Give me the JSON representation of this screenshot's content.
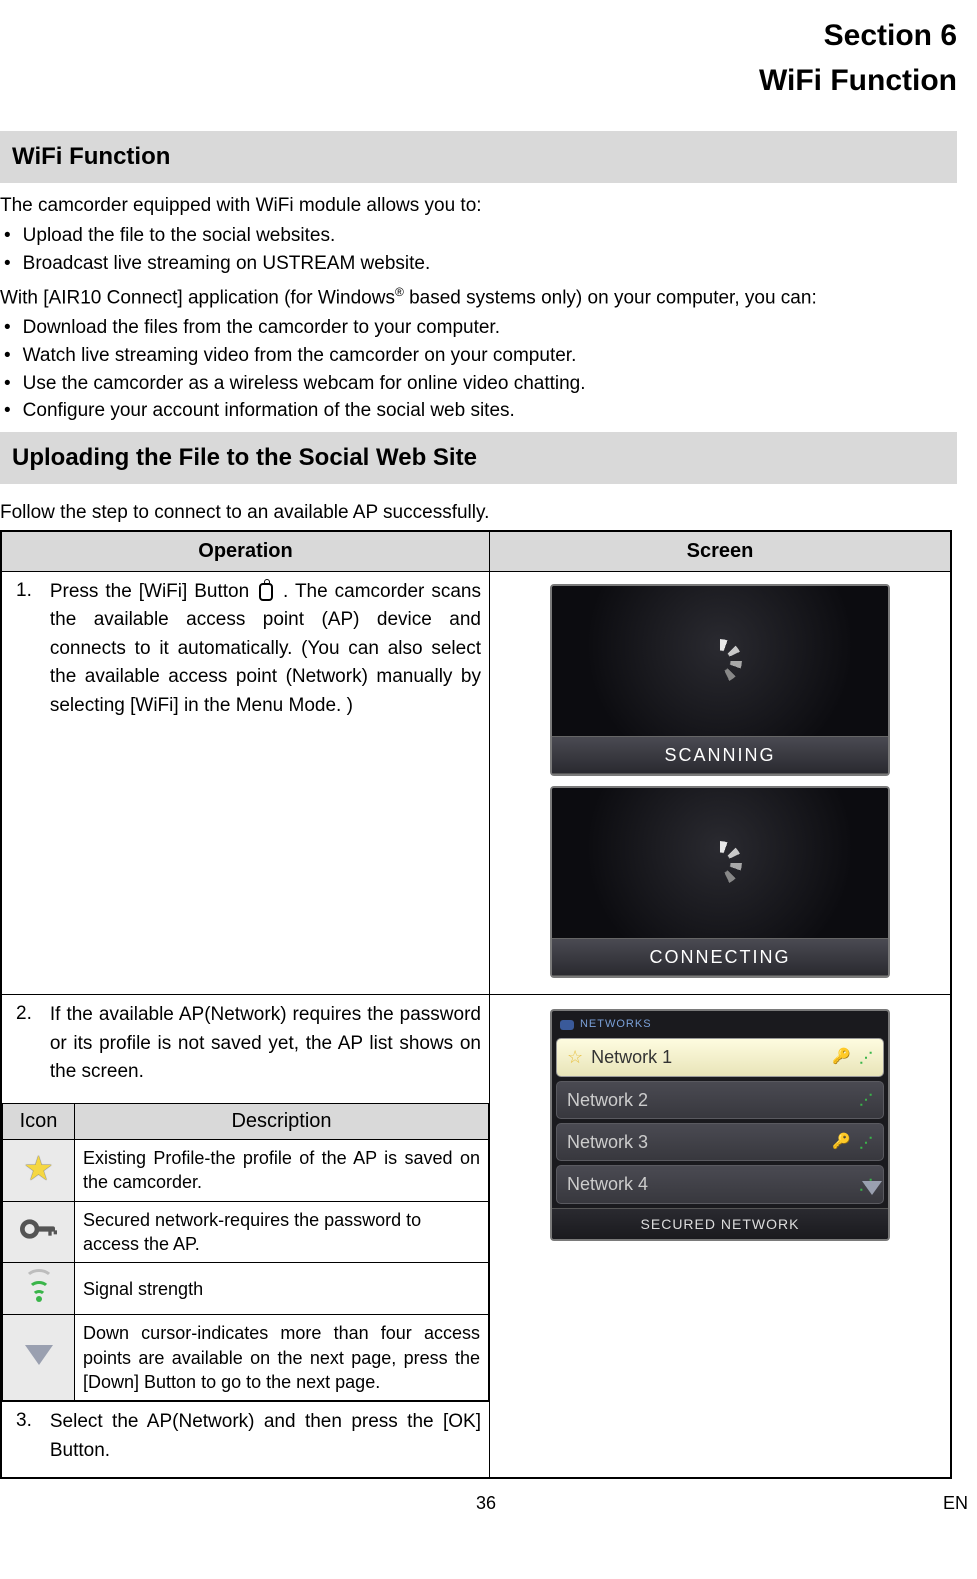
{
  "section": {
    "label": "Section 6",
    "title": "WiFi Function"
  },
  "bars": {
    "wifi_function": "WiFi Function",
    "uploading": "Uploading the File to the Social Web Site"
  },
  "intro": {
    "lead": "The camcorder equipped with WiFi module allows you to:",
    "bullets1": [
      "Upload the file to the social websites.",
      "Broadcast live streaming on USTREAM website."
    ],
    "with_line_pre": "With [AIR10 Connect] application (for Windows",
    "with_line_sup": "®",
    "with_line_post": " based systems only) on your computer, you can:",
    "bullets2": [
      "Download the files from the camcorder to your computer.",
      "Watch live streaming video from the camcorder on your computer.",
      "Use the camcorder as a wireless webcam for online video chatting.",
      "Configure your account information of the social web sites."
    ]
  },
  "follow_text": "Follow the step to connect to an available AP successfully.",
  "table": {
    "head": {
      "operation": "Operation",
      "screen": "Screen"
    },
    "row1": {
      "num": "1.",
      "text_pre": "Press the [WiFi] Button ",
      "text_post": " . The camcorder scans the available access point (AP) device and connects to it automatically.  (You can also select the available access point (Network) manually by selecting [WiFi] in the Menu Mode. )",
      "screen_labels": {
        "scanning": "SCANNING",
        "connecting": "CONNECTING"
      }
    },
    "row2": {
      "num": "2.",
      "text": "If the available AP(Network) requires the password or its profile is not saved yet, the AP list shows on the screen.",
      "networks_title": "NETWORKS",
      "networks": [
        {
          "name": "Network 1",
          "star": true,
          "lock": true,
          "signal": true,
          "selected": true
        },
        {
          "name": "Network 2",
          "star": false,
          "lock": false,
          "signal": true,
          "selected": false
        },
        {
          "name": "Network 3",
          "star": false,
          "lock": true,
          "signal": true,
          "selected": false
        },
        {
          "name": "Network 4",
          "star": false,
          "lock": false,
          "signal": true,
          "selected": false
        }
      ],
      "networks_footer": "SECURED NETWORK",
      "inner": {
        "head_icon": "Icon",
        "head_desc": "Description",
        "rows": [
          "Existing Profile-the profile of the AP is saved on the camcorder.",
          "Secured network-requires the password to access the AP.",
          "Signal strength",
          "Down cursor-indicates more than four access points are available on the next page, press the [Down] Button to go to the next page."
        ]
      }
    },
    "row3": {
      "num": "3.",
      "text": "Select the AP(Network) and then press the [OK] Button."
    }
  },
  "footer": {
    "page": "36",
    "lang": "EN"
  }
}
